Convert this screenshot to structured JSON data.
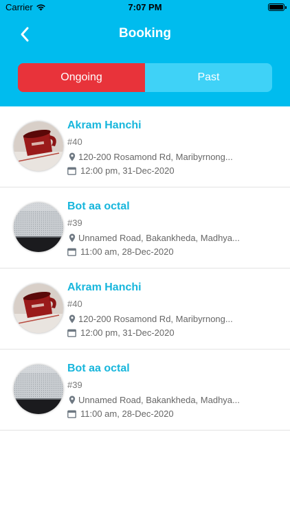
{
  "status_bar": {
    "carrier": "Carrier",
    "time": "7:07 PM",
    "wifi_icon": "wifi-icon",
    "battery_icon": "battery-icon"
  },
  "nav": {
    "title": "Booking",
    "back_icon": "chevron-left-icon"
  },
  "tabs": [
    {
      "label": "Ongoing",
      "active": true
    },
    {
      "label": "Past",
      "active": false
    }
  ],
  "bookings": [
    {
      "name": "Akram Hanchi",
      "number": "#40",
      "address": "120-200 Rosamond Rd, Maribyrnong...",
      "datetime": "12:00 pm, 31-Dec-2020",
      "avatar": "red-mug-photo"
    },
    {
      "name": "Bot aa octal",
      "number": "#39",
      "address": "Unnamed Road, Bakankheda, Madhya...",
      "datetime": "11:00 am, 28-Dec-2020",
      "avatar": "grey-texture-photo"
    },
    {
      "name": "Akram Hanchi",
      "number": "#40",
      "address": "120-200 Rosamond Rd, Maribyrnong...",
      "datetime": "12:00 pm, 31-Dec-2020",
      "avatar": "red-mug-photo"
    },
    {
      "name": "Bot aa octal",
      "number": "#39",
      "address": "Unnamed Road, Bakankheda, Madhya...",
      "datetime": "11:00 am, 28-Dec-2020",
      "avatar": "grey-texture-photo"
    }
  ],
  "colors": {
    "header": "#00bcee",
    "active_tab": "#e8333a",
    "inactive_tab": "#3fd2f7",
    "name_text": "#17b6dc"
  }
}
